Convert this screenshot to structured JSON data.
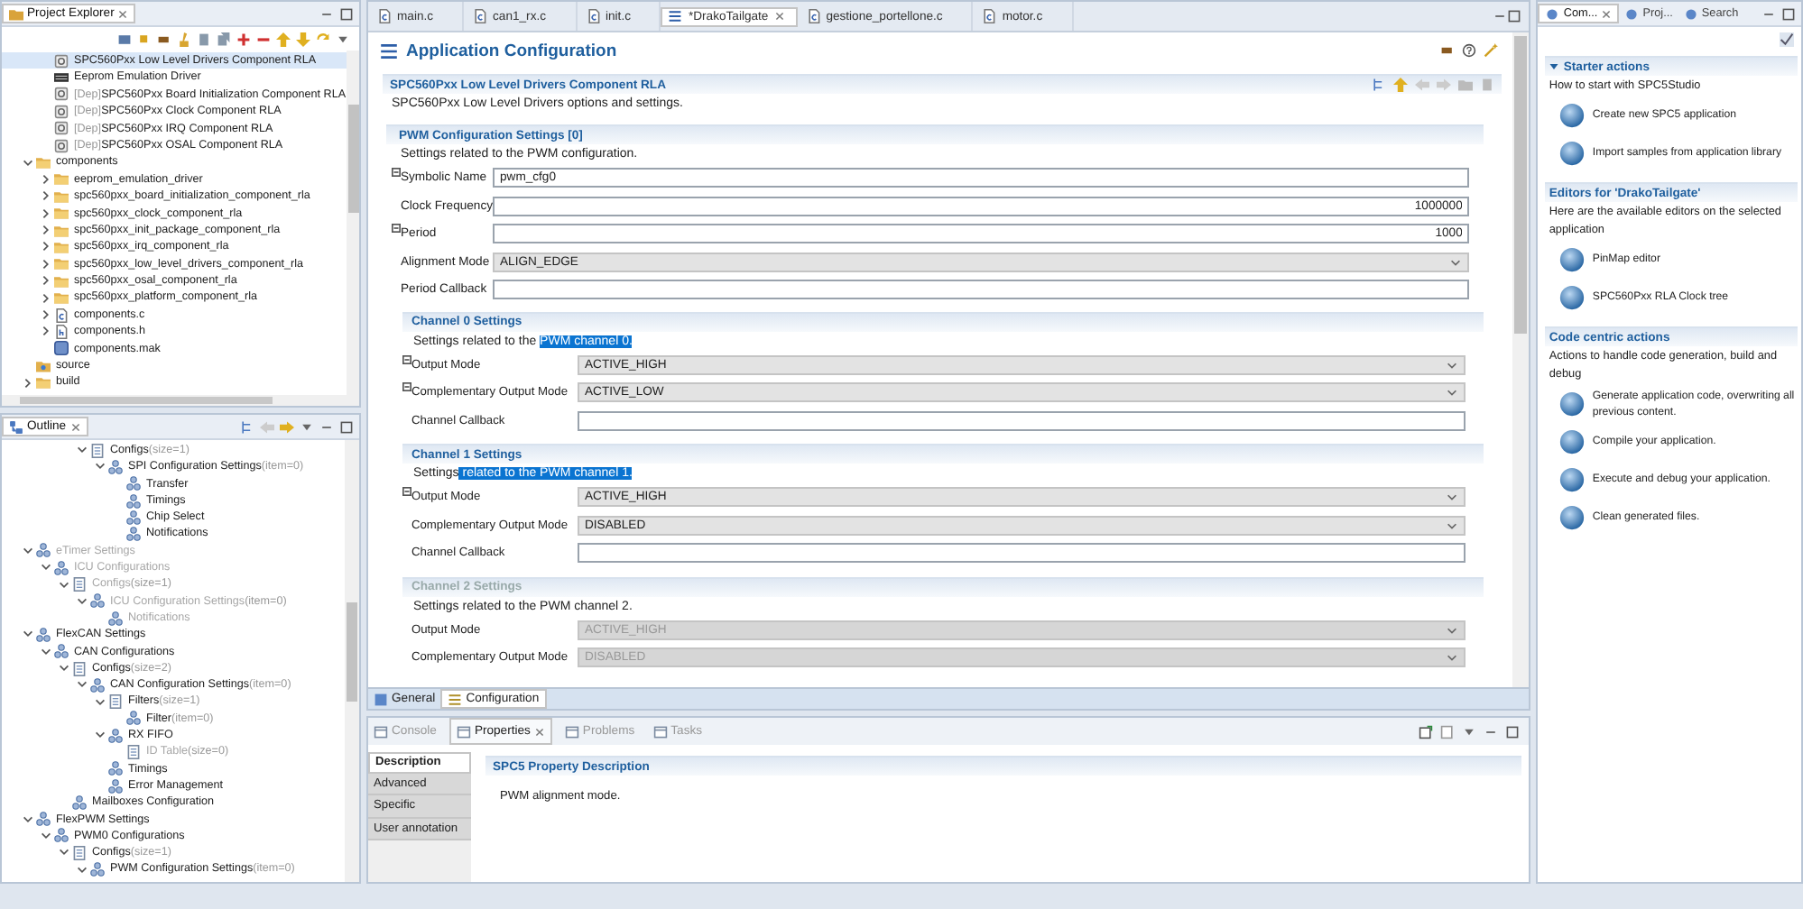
{
  "project_explorer": {
    "title": "Project Explorer",
    "items": [
      {
        "children": [
          {
            "label": "SPC560Pxx Low Level Drivers Component RLA",
            "kind": "component",
            "selected": true
          },
          {
            "label": "Eeprom Emulation Driver",
            "kind": "driver",
            "selected": false
          },
          {
            "prefix": "[Dep]",
            "label": "SPC560Pxx Board Initialization Component RLA",
            "kind": "component",
            "selected": false
          },
          {
            "prefix": "[Dep]",
            "label": "SPC560Pxx Clock Component RLA",
            "kind": "component",
            "selected": false
          },
          {
            "prefix": "[Dep]",
            "label": "SPC560Pxx IRQ Component RLA",
            "kind": "component",
            "selected": false
          },
          {
            "prefix": "[Dep]",
            "label": "SPC560Pxx OSAL Component RLA",
            "kind": "component",
            "selected": false
          }
        ]
      },
      {
        "label": "components",
        "kind": "folder",
        "expanded": true,
        "selected": false,
        "children": [
          {
            "label": "eeprom_emulation_driver",
            "kind": "folder",
            "expanded": false,
            "selected": false
          },
          {
            "label": "spc560pxx_board_initialization_component_rla",
            "kind": "folder",
            "expanded": false,
            "selected": false
          },
          {
            "label": "spc560pxx_clock_component_rla",
            "kind": "folder",
            "expanded": false,
            "selected": false
          },
          {
            "label": "spc560pxx_init_package_component_rla",
            "kind": "folder",
            "expanded": false,
            "selected": false
          },
          {
            "label": "spc560pxx_irq_component_rla",
            "kind": "folder",
            "expanded": false,
            "selected": false
          },
          {
            "label": "spc560pxx_low_level_drivers_component_rla",
            "kind": "folder",
            "expanded": false,
            "selected": false
          },
          {
            "label": "spc560pxx_osal_component_rla",
            "kind": "folder",
            "expanded": false,
            "selected": false
          },
          {
            "label": "spc560pxx_platform_component_rla",
            "kind": "folder",
            "expanded": false,
            "selected": false
          },
          {
            "label": "components.c",
            "kind": "c-file",
            "expanded": false,
            "selected": false
          },
          {
            "label": "components.h",
            "kind": "h-file",
            "expanded": false,
            "selected": false
          },
          {
            "label": "components.mak",
            "kind": "make-file",
            "selected": false
          }
        ]
      },
      {
        "label": "source",
        "kind": "source-folder",
        "selected": false
      },
      {
        "label": "build",
        "kind": "folder",
        "expanded": false,
        "selected": false
      }
    ]
  },
  "outline": {
    "title": "Outline",
    "items": [
      {
        "children": [
          {
            "children": [
              {
                "children": [
                  {
                    "label": "Configs",
                    "detail": "(size=1)",
                    "kind": "list",
                    "expanded": true,
                    "disabled": false,
                    "children": [
                      {
                        "label": "SPI Configuration Settings",
                        "detail": "(item=0)",
                        "kind": "node",
                        "expanded": true,
                        "disabled": false,
                        "children": [
                          {
                            "label": "Transfer",
                            "kind": "node",
                            "disabled": false
                          },
                          {
                            "label": "Timings",
                            "kind": "node",
                            "disabled": false
                          },
                          {
                            "label": "Chip Select",
                            "kind": "node",
                            "disabled": false
                          },
                          {
                            "label": "Notifications",
                            "kind": "node",
                            "disabled": false
                          }
                        ]
                      }
                    ]
                  }
                ]
              }
            ]
          }
        ]
      },
      {
        "label": "eTimer Settings",
        "kind": "node",
        "expanded": true,
        "disabled": true,
        "children": [
          {
            "label": "ICU Configurations",
            "kind": "node",
            "expanded": true,
            "disabled": true,
            "children": [
              {
                "label": "Configs",
                "detail": "(size=1)",
                "kind": "list",
                "expanded": true,
                "disabled": true,
                "children": [
                  {
                    "label": "ICU Configuration Settings",
                    "detail": "(item=0)",
                    "kind": "node",
                    "expanded": true,
                    "disabled": true,
                    "children": [
                      {
                        "label": "Notifications",
                        "kind": "node",
                        "disabled": true
                      }
                    ]
                  }
                ]
              }
            ]
          }
        ]
      },
      {
        "label": "FlexCAN Settings",
        "kind": "node",
        "expanded": true,
        "disabled": false,
        "children": [
          {
            "label": "CAN Configurations",
            "kind": "node",
            "expanded": true,
            "disabled": false,
            "children": [
              {
                "label": "Configs",
                "detail": "(size=2)",
                "kind": "list",
                "expanded": true,
                "disabled": false,
                "children": [
                  {
                    "label": "CAN Configuration Settings",
                    "detail": "(item=0)",
                    "kind": "node",
                    "expanded": true,
                    "disabled": false,
                    "children": [
                      {
                        "label": "Filters",
                        "detail": "(size=1)",
                        "kind": "list",
                        "expanded": true,
                        "disabled": false,
                        "children": [
                          {
                            "label": "Filter",
                            "detail": "(item=0)",
                            "kind": "node",
                            "disabled": false
                          }
                        ]
                      },
                      {
                        "label": "RX FIFO",
                        "kind": "node",
                        "expanded": true,
                        "disabled": false,
                        "children": [
                          {
                            "label": "ID Table",
                            "detail": "(size=0)",
                            "kind": "list",
                            "disabled": true
                          }
                        ]
                      },
                      {
                        "label": "Timings",
                        "kind": "node",
                        "disabled": false
                      },
                      {
                        "label": "Error Management",
                        "kind": "node",
                        "disabled": false
                      }
                    ]
                  }
                ]
              },
              {
                "label": "Mailboxes Configuration",
                "kind": "node",
                "disabled": false
              }
            ]
          }
        ]
      },
      {
        "label": "FlexPWM Settings",
        "kind": "node",
        "expanded": true,
        "disabled": false,
        "children": [
          {
            "label": "PWM0 Configurations",
            "kind": "node",
            "expanded": true,
            "disabled": false,
            "children": [
              {
                "label": "Configs",
                "detail": "(size=1)",
                "kind": "list",
                "expanded": true,
                "disabled": false,
                "children": [
                  {
                    "label": "PWM Configuration Settings",
                    "detail": "(item=0)",
                    "kind": "node",
                    "expanded": true,
                    "disabled": false
                  }
                ]
              }
            ]
          }
        ]
      }
    ]
  },
  "editor_tabs": [
    {
      "label": "main.c",
      "kind": "c-file",
      "selected": false
    },
    {
      "label": "can1_rx.c",
      "kind": "c-file",
      "selected": false
    },
    {
      "label": "init.c",
      "kind": "c-file",
      "selected": false
    },
    {
      "label": "*DrakoTailgate",
      "kind": "config",
      "selected": true
    },
    {
      "label": "gestione_portellone.c",
      "kind": "c-file",
      "selected": false
    },
    {
      "label": "motor.c",
      "kind": "c-file",
      "selected": false
    }
  ],
  "editor": {
    "title": "Application Configuration",
    "component": {
      "title": "SPC560Pxx Low Level Drivers Component RLA",
      "description": "SPC560Pxx Low Level Drivers options and settings."
    },
    "group": {
      "title": "PWM Configuration Settings [0]",
      "description": [
        {
          "text": "Settings related to the PWM configuration.",
          "selected": false
        }
      ],
      "fields": [
        {
          "label": "Symbolic Name",
          "kind": "text",
          "value": "pwm_cfg0",
          "marker": true
        },
        {
          "label": "Clock Frequency",
          "kind": "number",
          "value": "1000000",
          "marker": false
        },
        {
          "label": "Period",
          "kind": "number",
          "value": "1000",
          "marker": true
        },
        {
          "label": "Alignment Mode",
          "kind": "select",
          "value": "ALIGN_EDGE",
          "marker": false
        },
        {
          "label": "Period Callback",
          "kind": "text",
          "marker": false
        }
      ]
    },
    "channels": [
      {
        "title": "Channel 0 Settings",
        "disabled": false,
        "description": [
          {
            "text": "Settings related to the ",
            "selected": false
          },
          {
            "text": "PWM channel 0.",
            "selected": true
          }
        ],
        "fields": [
          {
            "label": "Output Mode",
            "kind": "select",
            "value": "ACTIVE_HIGH",
            "marker": true
          },
          {
            "label": "Complementary Output Mode",
            "kind": "select",
            "value": "ACTIVE_LOW",
            "marker": true
          },
          {
            "label": "Channel Callback",
            "kind": "text",
            "marker": false
          }
        ]
      },
      {
        "title": "Channel 1 Settings",
        "disabled": false,
        "description": [
          {
            "text": "Settings",
            "selected": false
          },
          {
            "text": " related to the PWM channel 1.",
            "selected": true
          }
        ],
        "fields": [
          {
            "label": "Output Mode",
            "kind": "select",
            "value": "ACTIVE_HIGH",
            "marker": true
          },
          {
            "label": "Complementary Output Mode",
            "kind": "select",
            "value": "DISABLED",
            "marker": false
          },
          {
            "label": "Channel Callback",
            "kind": "text",
            "marker": false
          }
        ]
      },
      {
        "title": "Channel 2 Settings",
        "disabled": true,
        "description": [
          {
            "text": "Settings related to the PWM channel 2.",
            "selected": false
          }
        ],
        "fields": [
          {
            "label": "Output Mode",
            "kind": "select",
            "value": "ACTIVE_HIGH",
            "marker": false
          },
          {
            "label": "Complementary Output Mode",
            "kind": "select",
            "value": "DISABLED",
            "marker": false
          }
        ]
      }
    ],
    "bottom_tabs": [
      {
        "label": "General",
        "selected": false
      },
      {
        "label": "Configuration",
        "selected": true
      }
    ]
  },
  "panel_tabs": [
    {
      "label": "Console",
      "selected": false
    },
    {
      "label": "Properties",
      "selected": true
    },
    {
      "label": "Problems",
      "selected": false
    },
    {
      "label": "Tasks",
      "selected": false
    }
  ],
  "properties": {
    "side_tabs": [
      {
        "label": "Description",
        "selected": true
      },
      {
        "label": "Advanced",
        "selected": false
      },
      {
        "label": "Specific",
        "selected": false
      },
      {
        "label": "User annotation",
        "selected": false
      }
    ],
    "title": "SPC5 Property Description",
    "text": "PWM alignment mode."
  },
  "cheat_sheet": {
    "tabs": [
      {
        "label": "Com...",
        "selected": true
      },
      {
        "label": "Proj...",
        "selected": false
      },
      {
        "label": "Search",
        "selected": false
      }
    ],
    "sections": [
      {
        "title": "Starter actions",
        "expanded": true,
        "description": "How to start with SPC5Studio",
        "actions": [
          "Create new SPC5 application",
          "Import samples from application library"
        ]
      },
      {
        "title": "Editors for 'DrakoTailgate'",
        "description": "Here are the available editors on the selected application",
        "actions": [
          "PinMap editor",
          "SPC560Pxx RLA Clock tree"
        ]
      },
      {
        "title": "Code centric actions",
        "description": "Actions to handle code generation, build and debug",
        "actions": [
          "Generate application code, overwriting all previous content.",
          "Compile your application.",
          "Execute and debug your application.",
          "Clean generated files."
        ]
      }
    ]
  }
}
